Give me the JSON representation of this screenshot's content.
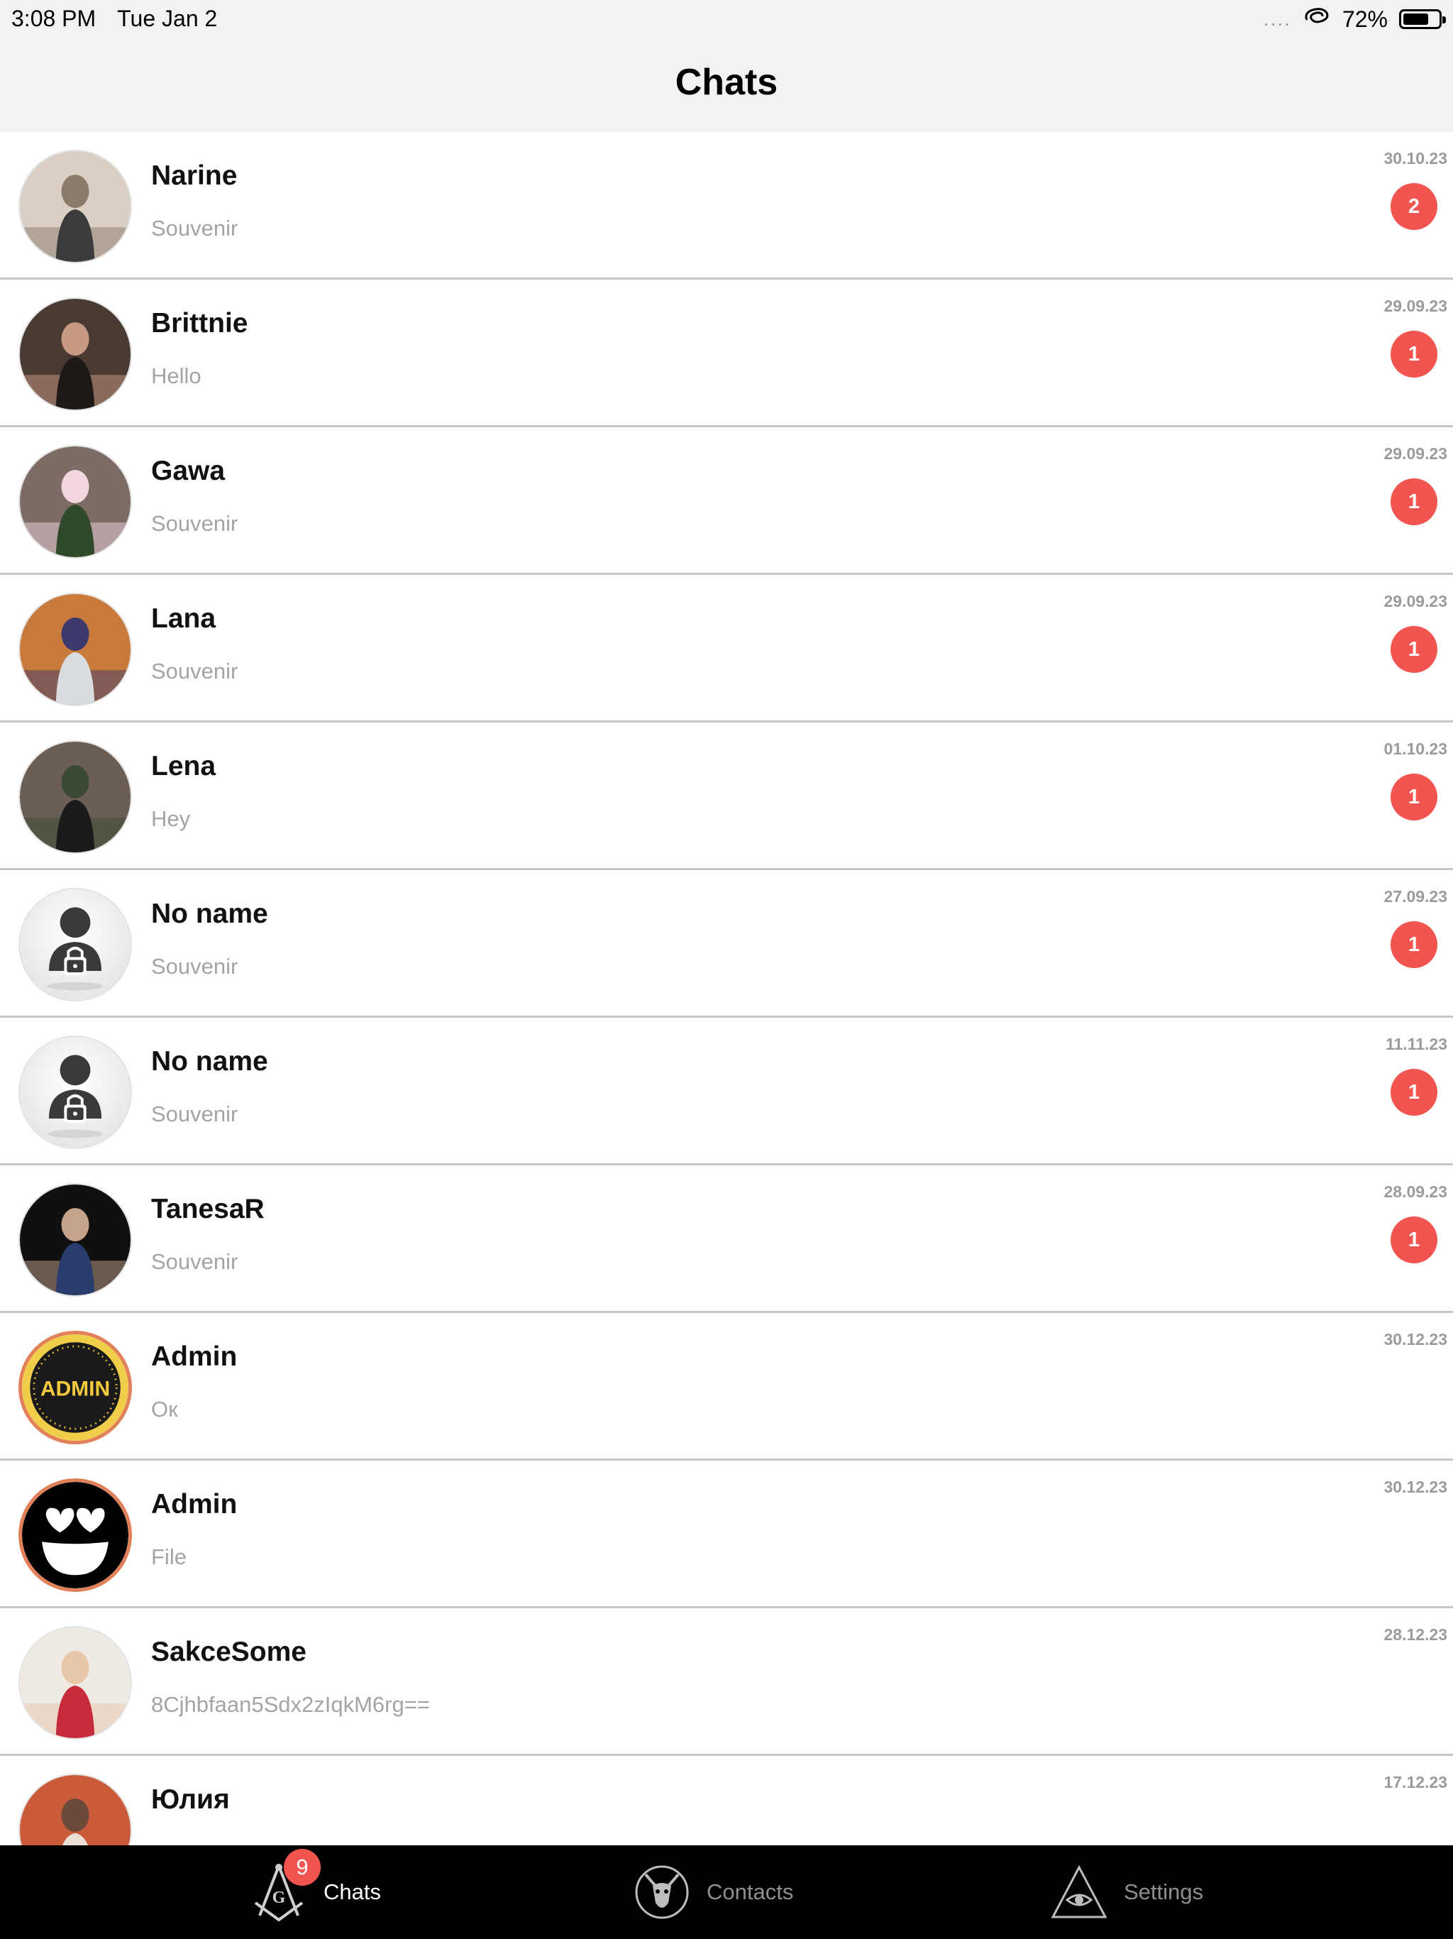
{
  "status_bar": {
    "time": "3:08 PM",
    "date": "Tue Jan 2",
    "signal": "....",
    "battery_percent": "72%",
    "battery_level": 0.72
  },
  "header": {
    "title": "Chats"
  },
  "chats": [
    {
      "name": "Narine",
      "preview": "Souvenir",
      "date": "30.10.23",
      "unread": "2",
      "avatar": "photo"
    },
    {
      "name": "Brittnie",
      "preview": "Hello",
      "date": "29.09.23",
      "unread": "1",
      "avatar": "photo"
    },
    {
      "name": "Gawa",
      "preview": "Souvenir",
      "date": "29.09.23",
      "unread": "1",
      "avatar": "photo"
    },
    {
      "name": "Lana",
      "preview": "Souvenir",
      "date": "29.09.23",
      "unread": "1",
      "avatar": "photo"
    },
    {
      "name": "Lena",
      "preview": "Hey",
      "date": "01.10.23",
      "unread": "1",
      "avatar": "photo"
    },
    {
      "name": "No name",
      "preview": "Souvenir",
      "date": "27.09.23",
      "unread": "1",
      "avatar": "locked-user-icon"
    },
    {
      "name": "No name",
      "preview": "Souvenir",
      "date": "11.11.23",
      "unread": "1",
      "avatar": "locked-user-icon"
    },
    {
      "name": "TanesaR",
      "preview": "Souvenir",
      "date": "28.09.23",
      "unread": "1",
      "avatar": "photo"
    },
    {
      "name": "Admin",
      "preview": "Ок",
      "date": "30.12.23",
      "unread": "",
      "avatar": "admin-logo",
      "avatar_text": "ADMIN"
    },
    {
      "name": "Admin",
      "preview": "File",
      "date": "30.12.23",
      "unread": "",
      "avatar": "heart-eyes-emoji"
    },
    {
      "name": "SakceSome",
      "preview": "8Cjhbfaan5Sdx2zIqkM6rg==",
      "date": "28.12.23",
      "unread": "",
      "avatar": "photo"
    },
    {
      "name": "Юлия",
      "preview": "",
      "date": "17.12.23",
      "unread": "",
      "avatar": "photo"
    }
  ],
  "tab_bar": {
    "tabs": [
      {
        "label": "Chats",
        "icon": "compass-square-icon",
        "badge": "9",
        "active": true
      },
      {
        "label": "Contacts",
        "icon": "goat-head-icon",
        "badge": "",
        "active": false
      },
      {
        "label": "Settings",
        "icon": "eye-pyramid-icon",
        "badge": "",
        "active": false
      }
    ]
  },
  "colors": {
    "badge": "#f2554f",
    "header_bg": "#f2f2f2",
    "divider": "#c6c6c6",
    "preview_text": "#a4a4a4",
    "tab_bar_bg": "#000000"
  }
}
